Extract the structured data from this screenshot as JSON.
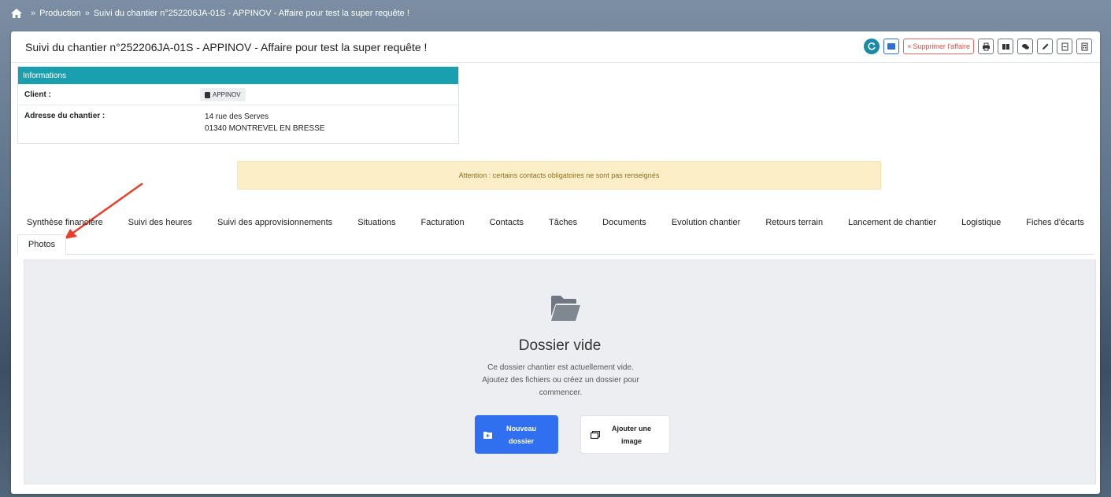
{
  "breadcrumb": {
    "items": [
      "Production",
      "Suivi du chantier n°252206JA-01S - APPINOV - Affaire pour test la super requête !"
    ]
  },
  "header": {
    "title": "Suivi du chantier n°252206JA-01S - APPINOV - Affaire pour test la super requête !",
    "delete_label": "Supprimer l'affaire"
  },
  "info": {
    "heading": "Informations",
    "client_label": "Client :",
    "client_value": "APPINOV",
    "address_label": "Adresse du chantier :",
    "address_line1": "14 rue des Serves",
    "address_line2": "01340 MONTREVEL EN BRESSE"
  },
  "warning": "Attention : certains contacts obligatoires ne sont pas renseignés",
  "tabs": {
    "items": [
      "Synthèse financière",
      "Suivi des heures",
      "Suivi des approvisionnements",
      "Situations",
      "Facturation",
      "Contacts",
      "Tâches",
      "Documents",
      "Evolution chantier",
      "Retours terrain",
      "Lancement de chantier",
      "Logistique",
      "Fiches d'écarts"
    ],
    "active": "Photos"
  },
  "empty_state": {
    "title": "Dossier vide",
    "line1": "Ce dossier chantier est actuellement vide.",
    "line2": "Ajoutez des fichiers ou créez un dossier pour",
    "line3": "commencer.",
    "new_folder_line1": "Nouveau",
    "new_folder_line2": "dossier",
    "add_image_line1": "Ajouter une",
    "add_image_line2": "image"
  },
  "colors": {
    "accent": "#1a9fae",
    "primary": "#2f6ff0",
    "danger": "#d9534f",
    "warning_bg": "#fcefc8",
    "annotation": "#e8402a"
  }
}
